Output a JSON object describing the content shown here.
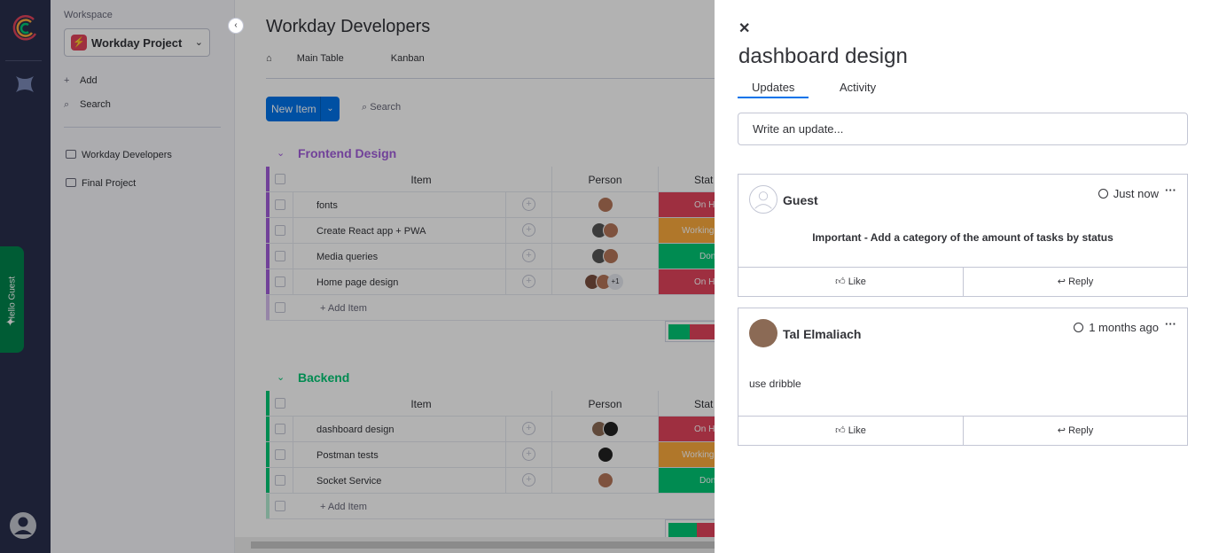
{
  "workspace": {
    "label": "Workspace",
    "project_badge": "⚡",
    "project_name": "Workday Project",
    "add_label": "Add",
    "search_label": "Search",
    "boards": [
      "Workday Developers",
      "Final Project"
    ]
  },
  "rail": {
    "hello_label": "Hello Guest"
  },
  "board": {
    "title": "Workday Developers",
    "views": [
      "Main Table",
      "Kanban"
    ],
    "new_item": "New Item",
    "search": "Search",
    "col_item": "Item",
    "col_person": "Person",
    "col_status": "Stat",
    "add_item": "+ Add Item",
    "groups": [
      {
        "name": "Frontend Design",
        "color": "#a25ddc",
        "rows": [
          {
            "item": "fonts",
            "status": "On H",
            "status_color": "#e2445c"
          },
          {
            "item": "Create React app + PWA",
            "status": "Working",
            "status_color": "#fdab3d"
          },
          {
            "item": "Media queries",
            "status": "Don",
            "status_color": "#00c875"
          },
          {
            "item": "Home page design",
            "status": "On H",
            "status_color": "#e2445c",
            "extra": "+1"
          }
        ]
      },
      {
        "name": "Backend",
        "color": "#00c875",
        "rows": [
          {
            "item": "dashboard design",
            "status": "On H",
            "status_color": "#e2445c"
          },
          {
            "item": "Postman tests",
            "status": "Working",
            "status_color": "#fdab3d"
          },
          {
            "item": "Socket Service",
            "status": "Don",
            "status_color": "#00c875"
          }
        ]
      }
    ]
  },
  "panel": {
    "title": "dashboard design",
    "tabs": [
      "Updates",
      "Activity"
    ],
    "update_placeholder": "Write an update...",
    "like": "Like",
    "reply": "Reply",
    "updates": [
      {
        "author": "Guest",
        "time": "Just now",
        "body": "Important - Add a category of the amount of tasks by status"
      },
      {
        "author": "Tal Elmaliach",
        "time": "1 months ago",
        "body": "use dribble"
      }
    ]
  }
}
